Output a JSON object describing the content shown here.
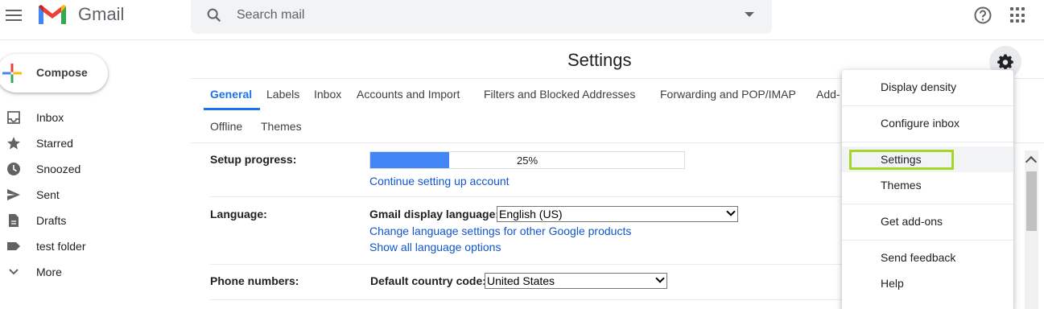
{
  "header": {
    "app_name": "Gmail",
    "search_placeholder": "Search mail"
  },
  "sidebar": {
    "compose_label": "Compose",
    "items": [
      {
        "label": "Inbox",
        "icon": "inbox-icon"
      },
      {
        "label": "Starred",
        "icon": "star-icon"
      },
      {
        "label": "Snoozed",
        "icon": "clock-icon"
      },
      {
        "label": "Sent",
        "icon": "send-icon"
      },
      {
        "label": "Drafts",
        "icon": "draft-icon"
      },
      {
        "label": "test folder",
        "icon": "label-icon"
      },
      {
        "label": "More",
        "icon": "chevron-down-icon"
      }
    ]
  },
  "main": {
    "title": "Settings",
    "tabs_row1": [
      "General",
      "Labels",
      "Inbox",
      "Accounts and Import",
      "Filters and Blocked Addresses",
      "Forwarding and POP/IMAP",
      "Add-"
    ],
    "tabs_row2": [
      "Offline",
      "Themes"
    ],
    "active_tab": "General",
    "setup_progress": {
      "label": "Setup progress:",
      "percent_text": "25%",
      "percent": 0.25,
      "link": "Continue setting up account"
    },
    "language": {
      "label": "Language:",
      "field_label": "Gmail display language:",
      "value": "English (US)",
      "link1": "Change language settings for other Google products",
      "link2": "Show all language options"
    },
    "phone": {
      "label": "Phone numbers:",
      "field_label": "Default country code:",
      "value": "United States"
    }
  },
  "menu": {
    "items": [
      "Display density",
      "Configure inbox",
      "Settings",
      "Themes",
      "Get add-ons",
      "Send feedback",
      "Help"
    ],
    "highlighted": "Settings"
  },
  "colors": {
    "accent": "#1a73e8",
    "highlight": "#a5d62b",
    "link": "#1155cc",
    "progress": "#4285f4"
  }
}
